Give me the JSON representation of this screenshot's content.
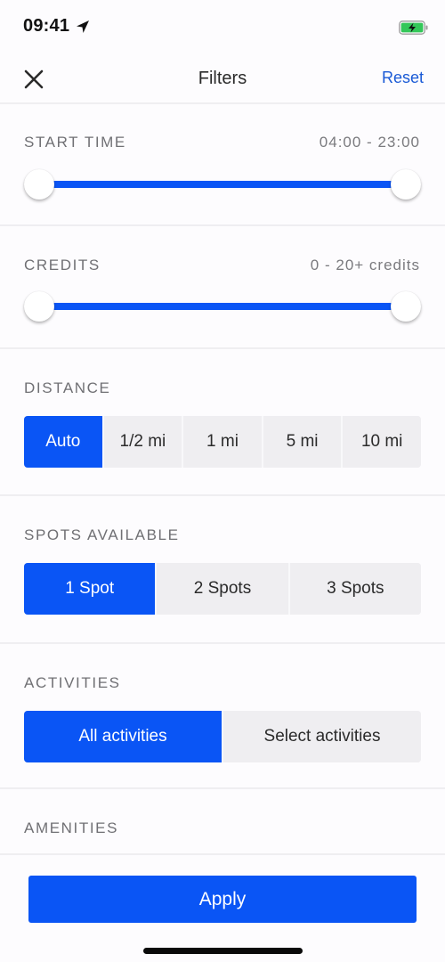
{
  "status_bar": {
    "time": "09:41",
    "location_icon": "location-arrow-icon",
    "battery_icon": "battery-charging-icon",
    "battery_color": "#34c759"
  },
  "nav": {
    "close_icon": "close-icon",
    "title": "Filters",
    "reset_label": "Reset"
  },
  "colors": {
    "accent": "#0a55f5",
    "link": "#1a5ad6",
    "segment_bg": "#efeef1",
    "label": "#707074"
  },
  "start_time": {
    "label": "START TIME",
    "value_text": "04:00 - 23:00",
    "range_min": 0,
    "range_max": 1,
    "low_fraction": 0,
    "high_fraction": 1
  },
  "credits": {
    "label": "CREDITS",
    "value_text": "0 - 20+ credits",
    "low_fraction": 0,
    "high_fraction": 1
  },
  "distance": {
    "label": "DISTANCE",
    "options": [
      "Auto",
      "1/2 mi",
      "1 mi",
      "5 mi",
      "10 mi"
    ],
    "selected": 0
  },
  "spots": {
    "label": "SPOTS AVAILABLE",
    "options": [
      "1 Spot",
      "2 Spots",
      "3 Spots"
    ],
    "selected": 0
  },
  "activities": {
    "label": "ACTIVITIES",
    "options": [
      "All activities",
      "Select activities"
    ],
    "selected": 0
  },
  "amenities": {
    "label": "AMENITIES"
  },
  "footer": {
    "apply_label": "Apply"
  }
}
